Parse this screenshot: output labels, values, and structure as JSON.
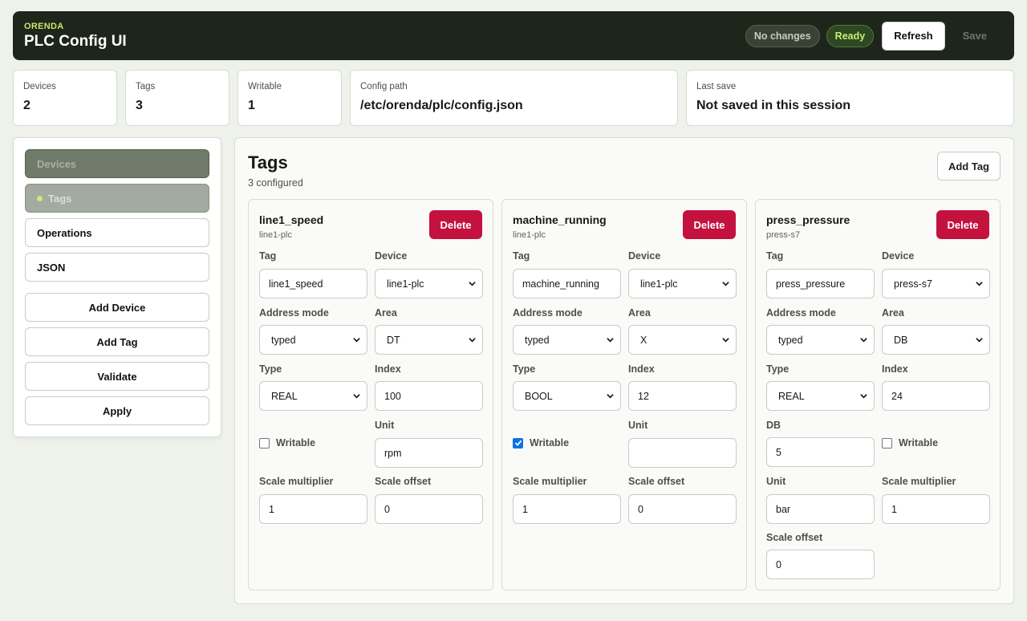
{
  "header": {
    "brand_small": "ORENDA",
    "title": "PLC Config UI",
    "status_changes": "No changes",
    "status_ready": "Ready",
    "refresh_label": "Refresh",
    "save_label": "Save"
  },
  "stats": {
    "devices": {
      "label": "Devices",
      "value": "2"
    },
    "tags": {
      "label": "Tags",
      "value": "3"
    },
    "writable": {
      "label": "Writable",
      "value": "1"
    },
    "config_path": {
      "label": "Config path",
      "value": "/etc/orenda/plc/config.json"
    },
    "last_save": {
      "label": "Last save",
      "value": "Not saved in this session"
    }
  },
  "sidebar": {
    "nav": [
      "Devices",
      "Tags",
      "Operations",
      "JSON"
    ],
    "actions": [
      "Add Device",
      "Add Tag",
      "Validate",
      "Apply"
    ]
  },
  "main": {
    "title": "Tags",
    "subtitle": "3 configured",
    "add_tag_label": "Add Tag"
  },
  "labels": {
    "delete": "Delete",
    "tag": "Tag",
    "device": "Device",
    "address_mode": "Address mode",
    "area": "Area",
    "type": "Type",
    "index": "Index",
    "unit": "Unit",
    "writable": "Writable",
    "scale_multiplier": "Scale multiplier",
    "scale_offset": "Scale offset",
    "db": "DB"
  },
  "tags": [
    {
      "name": "line1_speed",
      "device": "line1-plc",
      "tag": "line1_speed",
      "device_select": "line1-plc",
      "address_mode": "typed",
      "area": "DT",
      "type": "REAL",
      "index": "100",
      "unit": "rpm",
      "writable": false,
      "scale_multiplier": "1",
      "scale_offset": "0"
    },
    {
      "name": "machine_running",
      "device": "line1-plc",
      "tag": "machine_running",
      "device_select": "line1-plc",
      "address_mode": "typed",
      "area": "X",
      "type": "BOOL",
      "index": "12",
      "unit": "",
      "writable": true,
      "scale_multiplier": "1",
      "scale_offset": "0"
    },
    {
      "name": "press_pressure",
      "device": "press-s7",
      "tag": "press_pressure",
      "device_select": "press-s7",
      "address_mode": "typed",
      "area": "DB",
      "type": "REAL",
      "index": "24",
      "db": "5",
      "unit": "bar",
      "writable": false,
      "scale_multiplier": "1",
      "scale_offset": "0"
    }
  ],
  "colors": {
    "header_bg": "#1e261b",
    "accent_lime": "#c8ee73",
    "delete_red": "#c4123f",
    "checkbox_blue": "#0b72e7"
  }
}
